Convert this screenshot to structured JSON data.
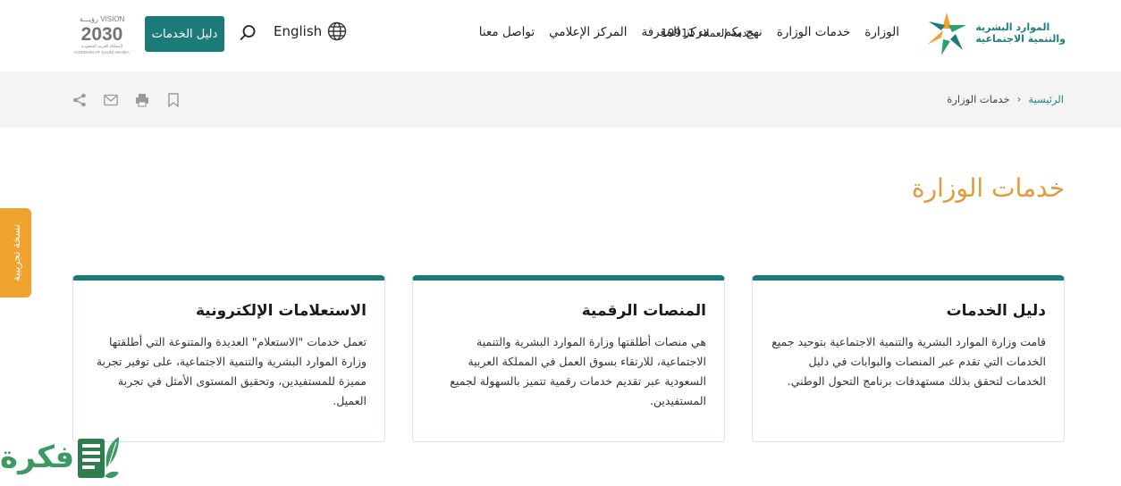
{
  "header": {
    "logo": {
      "line1": "الموارد البشرية",
      "line2": "والتنمية الاجتماعية"
    },
    "nav": [
      "الوزارة",
      "خدمات الوزارة",
      "نهج بكم",
      "مركز المعرفة",
      "المركز الإعلامي",
      "تواصل معنا"
    ],
    "customer_care": "خدمة العملاء 19911",
    "language": "English",
    "guide_button": "دليل الخدمات",
    "vision": {
      "top": "VISION رؤيـــة",
      "year": "2030",
      "sub": "المملكة العربية السعودية",
      "kingdom": "KINGDOM OF SAUDI ARABIA"
    }
  },
  "breadcrumb": {
    "home": "الرئيسية",
    "separator": "‹",
    "current": "خدمات الوزارة"
  },
  "page_title": "خدمات الوزارة",
  "side_tab": "نسخة تجريبية",
  "cards": [
    {
      "title": "دليل الخدمات",
      "text": "قامت وزارة الموارد البشرية والتنمية الاجتماعية بتوحيد جميع الخدمات التي تقدم عبر المنصات والبوابات في دليل الخدمات لتحقق بذلك مستهدفات برنامج التحول الوطني."
    },
    {
      "title": "المنصات الرقمية",
      "text": "هي منصات أطلقتها وزارة الموارد البشرية والتنمية الاجتماعية، للارتقاء بسوق العمل في المملكة العربية السعودية عبر تقديم خدمات رقمية تتميز بالسهولة لجميع المستفيدين."
    },
    {
      "title": "الاستعلامات الإلكترونية",
      "text": "تعمل خدمات \"الاستعلام\" العديدة والمتنوعة التي أطلقتها وزارة الموارد البشرية والتنمية الاجتماعية، على توفير تجربة مميزة للمستفيدين، وتحقيق المستوى الأمثل في تجربة العميل."
    }
  ],
  "watermark": "فكرة",
  "colors": {
    "brand": "#1c7a79",
    "accent": "#e39a3a",
    "tab": "#f0a42f"
  }
}
